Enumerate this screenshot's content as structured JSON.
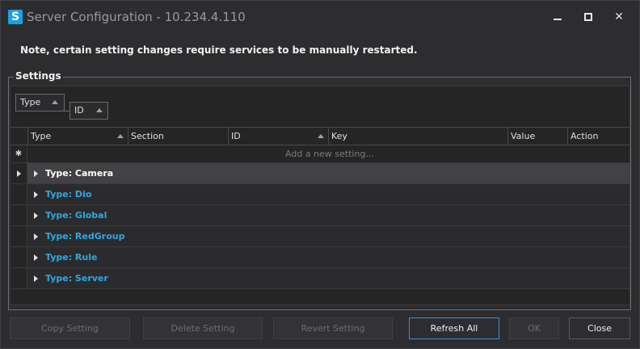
{
  "window": {
    "logo_letter": "S",
    "title": "Server Configuration - 10.234.4.110"
  },
  "note": "Note, certain setting changes require services to be manually restarted.",
  "settings": {
    "legend": "Settings",
    "group_by": [
      "Type",
      "ID"
    ],
    "columns": [
      "Type",
      "Section",
      "ID",
      "Key",
      "Value",
      "Action"
    ],
    "new_row_marker": "✱",
    "new_row_placeholder": "Add a new setting...",
    "groups": [
      {
        "label": "Type: Camera",
        "selected": true
      },
      {
        "label": "Type: Dio",
        "selected": false
      },
      {
        "label": "Type: Global",
        "selected": false
      },
      {
        "label": "Type: RedGroup",
        "selected": false
      },
      {
        "label": "Type: Rule",
        "selected": false
      },
      {
        "label": "Type: Server",
        "selected": false
      }
    ]
  },
  "buttons": {
    "copy": "Copy Setting",
    "delete": "Delete Setting",
    "revert": "Revert Setting",
    "refresh": "Refresh All",
    "ok": "OK",
    "close": "Close"
  },
  "colors": {
    "background": "#2d2d30",
    "accent": "#2ea8e0",
    "primary_border": "#3d8fcf",
    "logo": "#1ba1e2"
  }
}
